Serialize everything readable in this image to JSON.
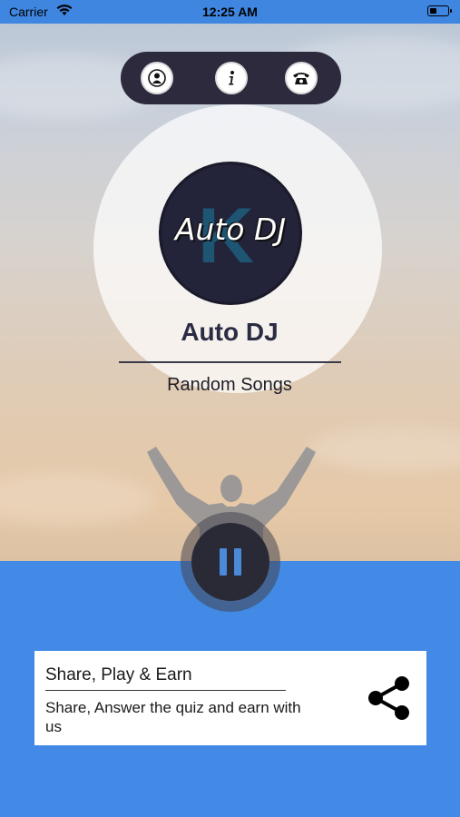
{
  "status_bar": {
    "carrier": "Carrier",
    "time": "12:25 AM"
  },
  "top_bar": {
    "buttons": [
      {
        "icon": "user-icon"
      },
      {
        "icon": "info-icon"
      },
      {
        "icon": "phone-icon"
      }
    ]
  },
  "station": {
    "logo_text": "Auto DJ",
    "title": "Auto DJ",
    "subtitle": "Random Songs"
  },
  "player": {
    "state": "playing",
    "control_icon": "pause-icon"
  },
  "promo_card": {
    "title": "Share, Play & Earn",
    "description": "Share, Answer the quiz and earn with us",
    "icon": "share-icon"
  },
  "colors": {
    "accent_blue": "#428ae5",
    "top_bar_bg": "#2d2a3e",
    "play_button_bg": "#2a2a36",
    "title_text": "#2a2c44"
  }
}
